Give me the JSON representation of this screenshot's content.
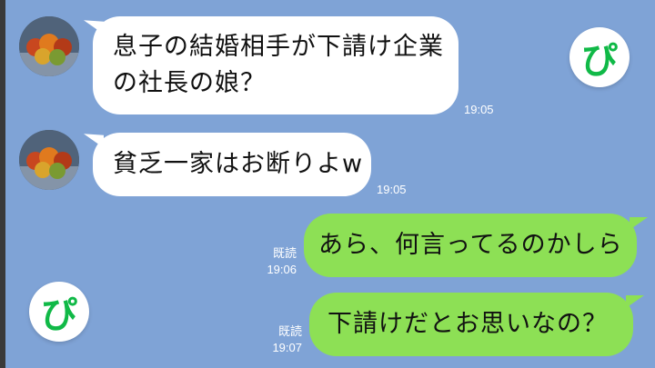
{
  "colors": {
    "background": "#7fa3d6",
    "incoming_bubble": "#ffffff",
    "outgoing_bubble": "#8de055",
    "logo_green": "#10b947"
  },
  "logo": {
    "glyph": "ぴ",
    "icon": "p-logo-icon"
  },
  "messages": [
    {
      "direction": "incoming",
      "lines": [
        "息子の結婚相手が下請け企業",
        "の社長の娘？"
      ],
      "time": "19:05"
    },
    {
      "direction": "incoming",
      "lines": [
        "貧乏一家はお断りよw"
      ],
      "time": "19:05"
    },
    {
      "direction": "outgoing",
      "lines": [
        "あら、何言ってるのかしら"
      ],
      "read": "既読",
      "time": "19:06"
    },
    {
      "direction": "outgoing",
      "lines": [
        "下請けだとお思いなの？"
      ],
      "read": "既読",
      "time": "19:07"
    }
  ]
}
